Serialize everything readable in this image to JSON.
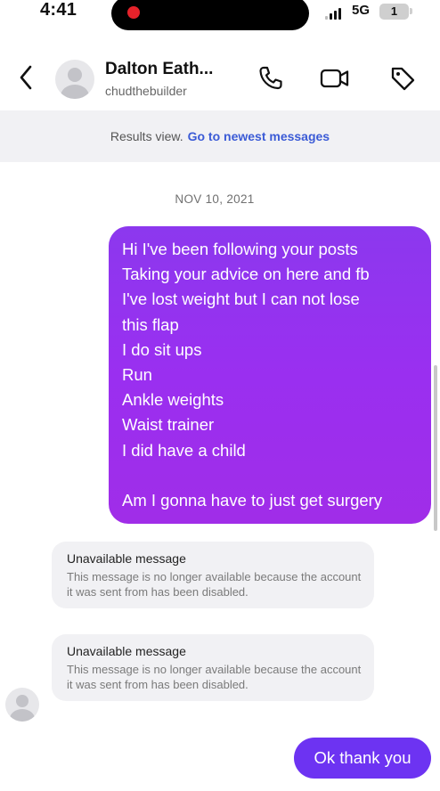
{
  "status_bar": {
    "time": "4:41",
    "network": "5G",
    "battery": "1"
  },
  "header": {
    "contact_name": "Dalton Eath...",
    "contact_handle": "chudthebuilder"
  },
  "results_banner": {
    "text": "Results view.",
    "link": "Go to newest messages"
  },
  "conversation": {
    "date": "NOV 10, 2021",
    "sent_message_lines": [
      "Hi I've been following your posts",
      "Taking your advice on here and fb",
      "I've lost weight but I can not lose",
      "this flap",
      "I do sit ups",
      "Run",
      "Ankle weights",
      "Waist trainer",
      "I did have a child",
      "",
      "Am I gonna have to just get surgery"
    ],
    "received": [
      {
        "title": "Unavailable message",
        "body": "This message is no longer available because the account it was sent from has been disabled."
      },
      {
        "title": "Unavailable message",
        "body": "This message is no longer available because the account it was sent from has been disabled."
      }
    ],
    "reply": "Ok thank you"
  },
  "colors": {
    "sent_bubble": "#9a2ff0",
    "reply_bubble": "#6d33f2",
    "received_bubble": "#f1f1f4",
    "link": "#3b5bd6",
    "recording_dot": "#e5222a"
  },
  "icons": [
    "back-arrow-icon",
    "phone-icon",
    "video-camera-icon",
    "tag-icon",
    "signal-icon",
    "battery-icon"
  ]
}
